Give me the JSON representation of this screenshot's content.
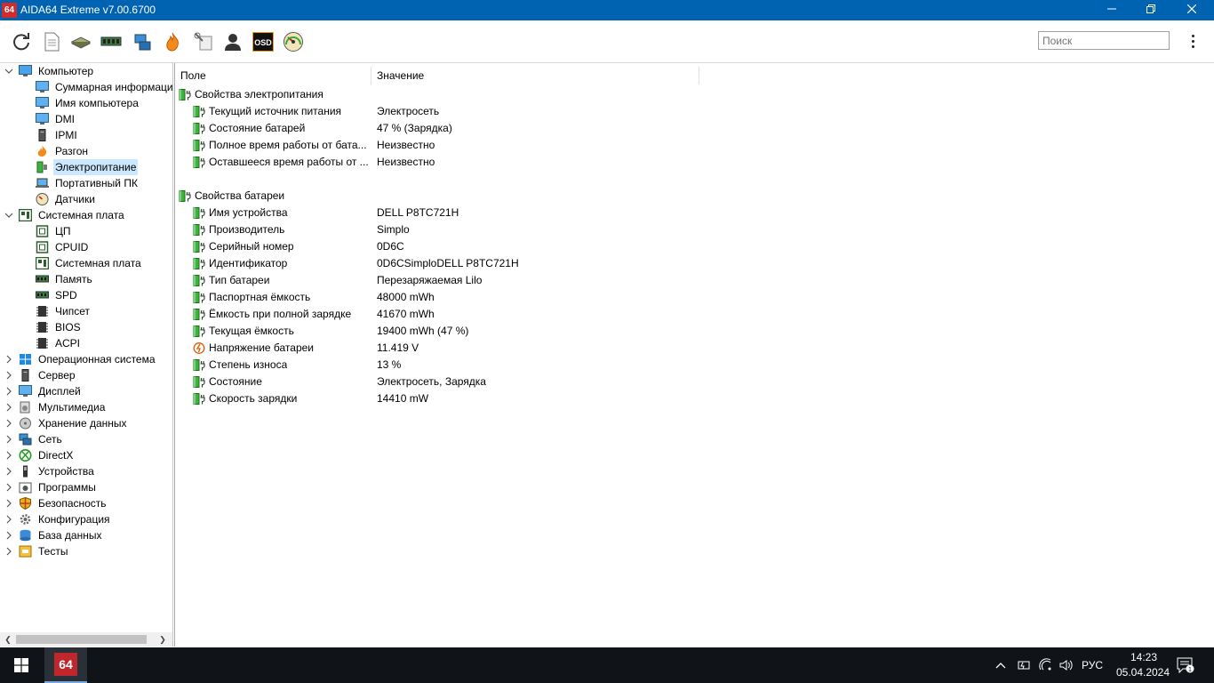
{
  "window": {
    "logo_text": "64",
    "title": "AIDA64 Extreme v7.00.6700",
    "min_icon": "minimize-icon",
    "max_icon": "restore-icon",
    "close_icon": "close-icon"
  },
  "toolbar": {
    "buttons": [
      "refresh-icon",
      "report-icon",
      "motherboard-icon",
      "memory-icon",
      "network-icon",
      "flame-icon",
      "tools-icon",
      "user-icon",
      "osd-icon",
      "speedometer-icon"
    ],
    "osd_label": "OSD",
    "search_placeholder": "Поиск"
  },
  "tree": {
    "items": [
      {
        "label": "Компьютер",
        "level": 0,
        "expanded": true,
        "icon": "computer-icon"
      },
      {
        "label": "Суммарная информация",
        "level": 1,
        "icon": "monitor-icon"
      },
      {
        "label": "Имя компьютера",
        "level": 1,
        "icon": "monitor-icon"
      },
      {
        "label": "DMI",
        "level": 1,
        "icon": "monitor-icon"
      },
      {
        "label": "IPMI",
        "level": 1,
        "icon": "server-icon"
      },
      {
        "label": "Разгон",
        "level": 1,
        "icon": "flame-icon"
      },
      {
        "label": "Электропитание",
        "level": 1,
        "icon": "battery-icon",
        "selected": true
      },
      {
        "label": "Портативный ПК",
        "level": 1,
        "icon": "laptop-icon"
      },
      {
        "label": "Датчики",
        "level": 1,
        "icon": "gauge-icon"
      },
      {
        "label": "Системная плата",
        "level": 0,
        "expanded": true,
        "icon": "motherboard-icon"
      },
      {
        "label": "ЦП",
        "level": 1,
        "icon": "cpu-icon"
      },
      {
        "label": "CPUID",
        "level": 1,
        "icon": "cpu-icon"
      },
      {
        "label": "Системная плата",
        "level": 1,
        "icon": "motherboard-icon"
      },
      {
        "label": "Память",
        "level": 1,
        "icon": "memory-icon"
      },
      {
        "label": "SPD",
        "level": 1,
        "icon": "memory-icon"
      },
      {
        "label": "Чипсет",
        "level": 1,
        "icon": "chip-icon"
      },
      {
        "label": "BIOS",
        "level": 1,
        "icon": "chip-icon"
      },
      {
        "label": "ACPI",
        "level": 1,
        "icon": "chip-icon"
      },
      {
        "label": "Операционная система",
        "level": 0,
        "icon": "windows-icon"
      },
      {
        "label": "Сервер",
        "level": 0,
        "icon": "server-icon"
      },
      {
        "label": "Дисплей",
        "level": 0,
        "icon": "monitor-icon"
      },
      {
        "label": "Мультимедиа",
        "level": 0,
        "icon": "multimedia-icon"
      },
      {
        "label": "Хранение данных",
        "level": 0,
        "icon": "storage-icon"
      },
      {
        "label": "Сеть",
        "level": 0,
        "icon": "network-icon"
      },
      {
        "label": "DirectX",
        "level": 0,
        "icon": "xbox-icon"
      },
      {
        "label": "Устройства",
        "level": 0,
        "icon": "devices-icon"
      },
      {
        "label": "Программы",
        "level": 0,
        "icon": "programs-icon"
      },
      {
        "label": "Безопасность",
        "level": 0,
        "icon": "shield-icon"
      },
      {
        "label": "Конфигурация",
        "level": 0,
        "icon": "config-icon"
      },
      {
        "label": "База данных",
        "level": 0,
        "icon": "database-icon"
      },
      {
        "label": "Тесты",
        "level": 0,
        "icon": "tests-icon"
      }
    ]
  },
  "table": {
    "col_field": "Поле",
    "col_value": "Значение",
    "rows": [
      {
        "type": "group",
        "field": "Свойства электропитания",
        "icon": "battery-plug-icon"
      },
      {
        "type": "item",
        "field": "Текущий источник питания",
        "value": "Электросеть",
        "icon": "battery-plug-icon"
      },
      {
        "type": "item",
        "field": "Состояние батарей",
        "value": "47 % (Зарядка)",
        "icon": "battery-plug-icon"
      },
      {
        "type": "item",
        "field": "Полное время работы от бата...",
        "value": "Неизвестно",
        "icon": "battery-plug-icon"
      },
      {
        "type": "item",
        "field": "Оставшееся время работы от ...",
        "value": "Неизвестно",
        "icon": "battery-plug-icon"
      },
      {
        "type": "blank"
      },
      {
        "type": "group",
        "field": "Свойства батареи",
        "icon": "battery-plug-icon"
      },
      {
        "type": "item",
        "field": "Имя устройства",
        "value": "DELL P8TC721H",
        "icon": "battery-plug-icon"
      },
      {
        "type": "item",
        "field": "Производитель",
        "value": "Simplo",
        "icon": "battery-plug-icon"
      },
      {
        "type": "item",
        "field": "Серийный номер",
        "value": "0D6C",
        "icon": "battery-plug-icon"
      },
      {
        "type": "item",
        "field": "Идентификатор",
        "value": "0D6CSimploDELL P8TC721H",
        "icon": "battery-plug-icon"
      },
      {
        "type": "item",
        "field": "Тип батареи",
        "value": "Перезаряжаемая Lilo",
        "icon": "battery-plug-icon"
      },
      {
        "type": "item",
        "field": "Паспортная ёмкость",
        "value": "48000 mWh",
        "icon": "battery-plug-icon"
      },
      {
        "type": "item",
        "field": "Ёмкость при полной зарядке",
        "value": "41670 mWh",
        "icon": "battery-plug-icon"
      },
      {
        "type": "item",
        "field": "Текущая ёмкость",
        "value": "19400 mWh  (47 %)",
        "icon": "battery-plug-icon"
      },
      {
        "type": "item",
        "field": "Напряжение батареи",
        "value": "11.419 V",
        "icon": "voltage-icon"
      },
      {
        "type": "item",
        "field": "Степень износа",
        "value": "13 %",
        "icon": "battery-plug-icon"
      },
      {
        "type": "item",
        "field": "Состояние",
        "value": "Электросеть, Зарядка",
        "icon": "battery-plug-icon"
      },
      {
        "type": "item",
        "field": "Скорость зарядки",
        "value": "14410 mW",
        "icon": "battery-plug-icon"
      }
    ]
  },
  "taskbar": {
    "app_label": "64",
    "language": "РУС",
    "time": "14:23",
    "date": "05.04.2024",
    "notification_count": "1"
  }
}
